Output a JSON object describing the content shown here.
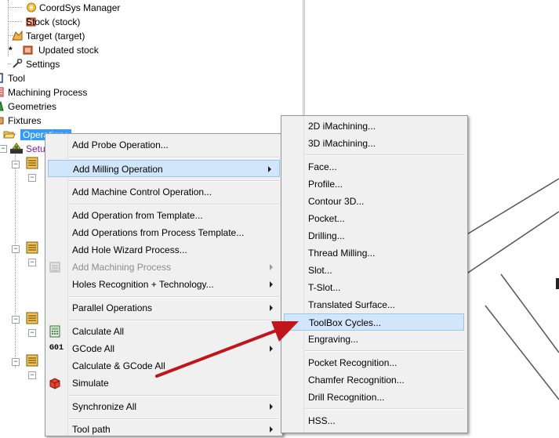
{
  "tree": {
    "items": [
      {
        "label": "CoordSys Manager"
      },
      {
        "label": "Stock (stock)"
      },
      {
        "label": "Target (target)"
      },
      {
        "label": "Updated stock",
        "prefix": "*"
      },
      {
        "label": "Settings"
      },
      {
        "label": "Tool"
      },
      {
        "label": "Machining Process"
      },
      {
        "label": "Geometries"
      },
      {
        "label": "Fixtures"
      },
      {
        "label": "Operations"
      },
      {
        "label": "Setup"
      }
    ]
  },
  "context_menu": {
    "items": [
      {
        "label": "Add Probe Operation..."
      },
      {
        "label": "Add Milling Operation"
      },
      {
        "label": "Add Machine Control Operation..."
      },
      {
        "label": "Add Operation from Template..."
      },
      {
        "label": "Add Operations from Process Template..."
      },
      {
        "label": "Add Hole Wizard Process..."
      },
      {
        "label": "Add Machining Process"
      },
      {
        "label": "Holes Recognition + Technology..."
      },
      {
        "label": "Parallel Operations"
      },
      {
        "label": "Calculate All"
      },
      {
        "label": "GCode All",
        "icon_text": "G01"
      },
      {
        "label": "Calculate & GCode All"
      },
      {
        "label": "Simulate"
      },
      {
        "label": "Synchronize All"
      },
      {
        "label": "Tool path"
      }
    ]
  },
  "submenu": {
    "items": [
      {
        "label": "2D iMachining..."
      },
      {
        "label": "3D iMachining..."
      },
      {
        "label": "Face..."
      },
      {
        "label": "Profile..."
      },
      {
        "label": "Contour 3D..."
      },
      {
        "label": "Pocket..."
      },
      {
        "label": "Drilling..."
      },
      {
        "label": "Thread Milling..."
      },
      {
        "label": "Slot..."
      },
      {
        "label": "T-Slot..."
      },
      {
        "label": "Translated Surface..."
      },
      {
        "label": "ToolBox Cycles..."
      },
      {
        "label": "Engraving..."
      },
      {
        "label": "Pocket Recognition..."
      },
      {
        "label": "Chamfer Recognition..."
      },
      {
        "label": "Drill Recognition..."
      },
      {
        "label": "HSS..."
      }
    ]
  },
  "colors": {
    "highlight": "#d1e6fa",
    "selection": "#3399ff",
    "annotation_arrow": "#c0161b"
  }
}
